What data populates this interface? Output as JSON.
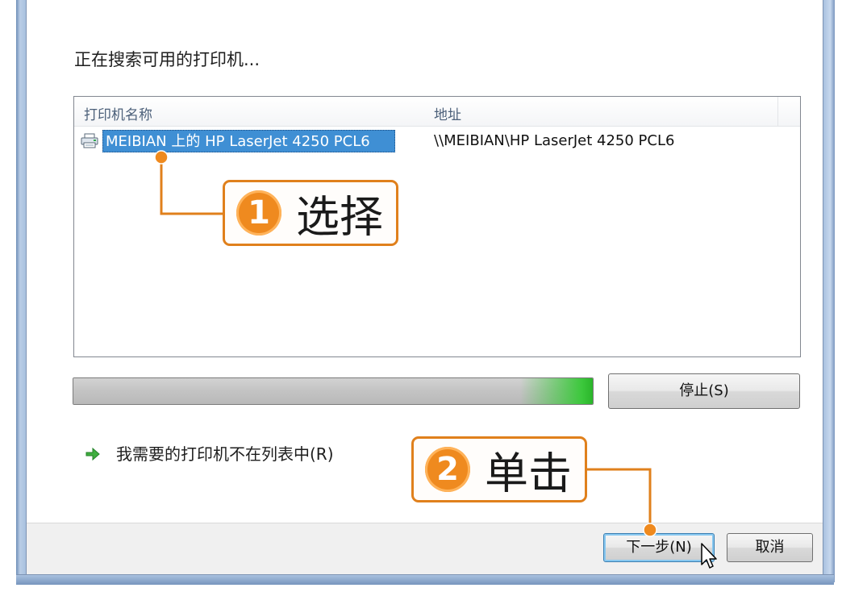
{
  "dialog": {
    "heading": "正在搜索可用的打印机..."
  },
  "printer_list": {
    "columns": [
      "打印机名称",
      "地址"
    ],
    "rows": [
      {
        "name": "MEIBIAN 上的 HP LaserJet 4250 PCL6",
        "address": "\\\\MEIBIAN\\HP LaserJet 4250 PCL6",
        "icon": "printer-icon",
        "selected": true
      }
    ]
  },
  "search_progress": {
    "percent": 100,
    "color": "#3cc83c"
  },
  "buttons": {
    "stop": "停止(S)",
    "next": "下一步(N)",
    "cancel": "取消"
  },
  "not_listed_link": {
    "text": "我需要的打印机不在列表中(R)",
    "icon": "green-arrow-icon"
  },
  "annotations": {
    "step1": {
      "number": "1",
      "text": "选择"
    },
    "step2": {
      "number": "2",
      "text": "单击"
    },
    "color": "#e0801c"
  }
}
